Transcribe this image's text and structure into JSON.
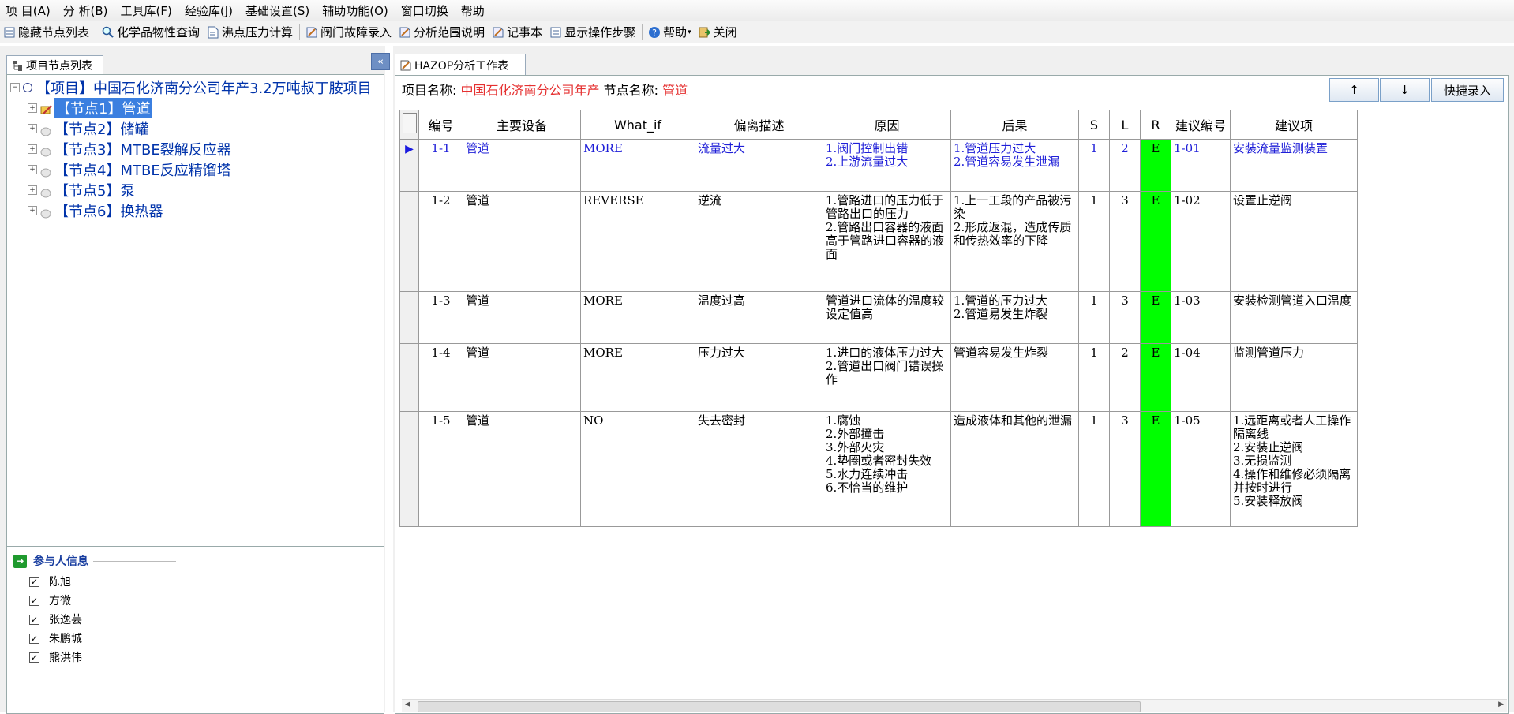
{
  "menu": [
    "项 目(A)",
    "分 析(B)",
    "工具库(F)",
    "经验库(J)",
    "基础设置(S)",
    "辅助功能(O)",
    "窗口切换",
    "帮助"
  ],
  "toolbar": [
    "隐藏节点列表",
    "化学品物性查询",
    "沸点压力计算",
    "阀门故障录入",
    "分析范围说明",
    "记事本",
    "显示操作步骤",
    "帮助",
    "关闭"
  ],
  "left": {
    "tab_label": "项目节点列表",
    "collapse_glyph": "«",
    "tree": {
      "root": "【项目】中国石化济南分公司年产3.2万吨叔丁胺项目",
      "nodes": [
        "【节点1】管道",
        "【节点2】储罐",
        "【节点3】MTBE裂解反应器",
        "【节点4】MTBE反应精馏塔",
        "【节点5】泵",
        "【节点6】换热器"
      ]
    },
    "participants": {
      "title": "参与人信息",
      "people": [
        "陈旭",
        "方微",
        "张逸芸",
        "朱鹏城",
        "熊洪伟"
      ]
    }
  },
  "right": {
    "tab_label": "HAZOP分析工作表",
    "project_label": "项目名称:",
    "project_value": "中国石化济南分公司年产",
    "node_label": "节点名称:",
    "node_value": "管道",
    "up_btn": "↑",
    "down_btn": "↓",
    "quick_btn": "快捷录入",
    "columns": [
      "编号",
      "主要设备",
      "What_if",
      "偏离描述",
      "原因",
      "后果",
      "S",
      "L",
      "R",
      "建议编号",
      "建议项"
    ],
    "rows": [
      {
        "id": "1-1",
        "equip": "管道",
        "whatif": "MORE",
        "deviation": "流量过大",
        "cause": "1.阀门控制出错\n2.上游流量过大",
        "consequence": "1.管道压力过大\n2.管道容易发生泄漏",
        "s": "1",
        "l": "2",
        "r": "E",
        "sug_id": "1-01",
        "suggestion": "安装流量监测装置"
      },
      {
        "id": "1-2",
        "equip": "管道",
        "whatif": "REVERSE",
        "deviation": "逆流",
        "cause": "1.管路进口的压力低于管路出口的压力\n2.管路出口容器的液面高于管路进口容器的液面",
        "consequence": "1.上一工段的产品被污染\n2.形成返混，造成传质和传热效率的下降",
        "s": "1",
        "l": "3",
        "r": "E",
        "sug_id": "1-02",
        "suggestion": "设置止逆阀"
      },
      {
        "id": "1-3",
        "equip": "管道",
        "whatif": "MORE",
        "deviation": "温度过高",
        "cause": "管道进口流体的温度较设定值高",
        "consequence": "1.管道的压力过大\n2.管道易发生炸裂",
        "s": "1",
        "l": "3",
        "r": "E",
        "sug_id": "1-03",
        "suggestion": "安装检测管道入口温度"
      },
      {
        "id": "1-4",
        "equip": "管道",
        "whatif": "MORE",
        "deviation": "压力过大",
        "cause": "1.进口的液体压力过大\n2.管道出口阀门错误操作",
        "consequence": "管道容易发生炸裂",
        "s": "1",
        "l": "2",
        "r": "E",
        "sug_id": "1-04",
        "suggestion": "监测管道压力"
      },
      {
        "id": "1-5",
        "equip": "管道",
        "whatif": "NO",
        "deviation": "失去密封",
        "cause": "1.腐蚀\n2.外部撞击\n3.外部火灾\n4.垫圈或者密封失效\n5.水力连续冲击\n6.不恰当的维护",
        "consequence": "造成液体和其他的泄漏",
        "s": "1",
        "l": "3",
        "r": "E",
        "sug_id": "1-05",
        "suggestion": "1.远距离或者人工操作隔离线\n2.安装止逆阀\n3.无损监测\n4.操作和维修必须隔离并按时进行\n5.安装释放阀"
      }
    ]
  },
  "colors": {
    "risk_fill": "#00ff00",
    "selected_row_text": "#1f1fd8",
    "project_name": "#e53030"
  }
}
